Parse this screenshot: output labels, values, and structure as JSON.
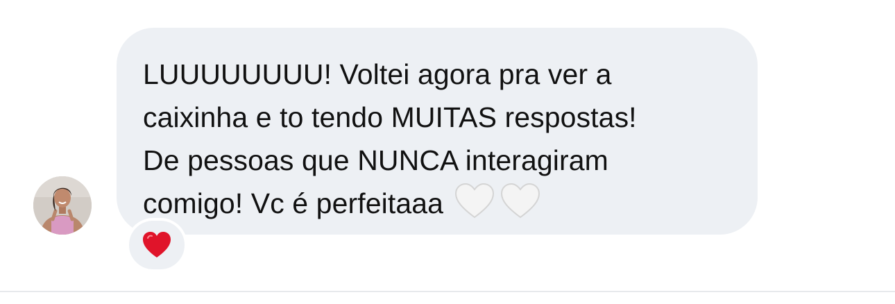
{
  "message": {
    "text": "LUUUUUUUU! Voltei agora pra ver a\ncaixinha e to tendo MUITAS respostas!\nDe pessoas que NUNCA interagiram\ncomigo! Vc é perfeitaaa",
    "trailing_emojis": [
      "white-heart",
      "white-heart"
    ]
  },
  "reaction": {
    "emoji": "red-heart"
  },
  "colors": {
    "bubble_background": "#edf0f4",
    "text": "#111111",
    "reaction_heart": "#e0142a",
    "white_heart": "#f2f2f2",
    "divider": "#e7e9ec"
  }
}
